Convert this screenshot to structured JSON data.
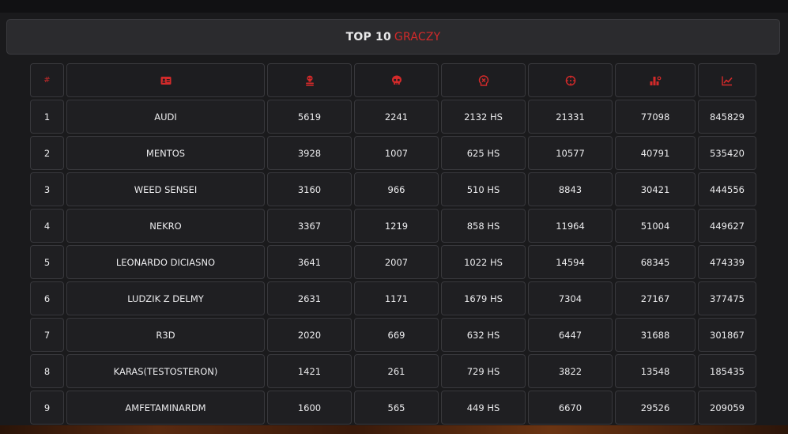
{
  "header": {
    "title_prefix": "TOP 10",
    "title_accent": "GRACZY"
  },
  "columns": [
    {
      "label": "#",
      "icon": "hash"
    },
    {
      "label": "",
      "icon": "id-card-icon"
    },
    {
      "label": "",
      "icon": "skull-crossbones-icon"
    },
    {
      "label": "",
      "icon": "skull-icon"
    },
    {
      "label": "",
      "icon": "headshot-icon"
    },
    {
      "label": "",
      "icon": "crosshair-icon"
    },
    {
      "label": "",
      "icon": "damage-icon"
    },
    {
      "label": "",
      "icon": "chart-line-icon"
    }
  ],
  "colors": {
    "accent": "#d42a2a",
    "background": "#1a1a1c",
    "cell_border": "#38383c"
  },
  "rows": [
    [
      "1",
      "AUDI",
      "5619",
      "2241",
      "2132 HS",
      "21331",
      "77098",
      "845829"
    ],
    [
      "2",
      "MENTOS",
      "3928",
      "1007",
      "625 HS",
      "10577",
      "40791",
      "535420"
    ],
    [
      "3",
      "WEED SENSEI",
      "3160",
      "966",
      "510 HS",
      "8843",
      "30421",
      "444556"
    ],
    [
      "4",
      "NEKRO",
      "3367",
      "1219",
      "858 HS",
      "11964",
      "51004",
      "449627"
    ],
    [
      "5",
      "LEONARDO DICIASNO",
      "3641",
      "2007",
      "1022 HS",
      "14594",
      "68345",
      "474339"
    ],
    [
      "6",
      "LUDZIK Z DELMY",
      "2631",
      "1171",
      "1679 HS",
      "7304",
      "27167",
      "377475"
    ],
    [
      "7",
      "R3D",
      "2020",
      "669",
      "632 HS",
      "6447",
      "31688",
      "301867"
    ],
    [
      "8",
      "KARAS(TESTOSTERON)",
      "1421",
      "261",
      "729 HS",
      "3822",
      "13548",
      "185435"
    ],
    [
      "9",
      "AMFETAMINARDM",
      "1600",
      "565",
      "449 HS",
      "6670",
      "29526",
      "209059"
    ]
  ]
}
